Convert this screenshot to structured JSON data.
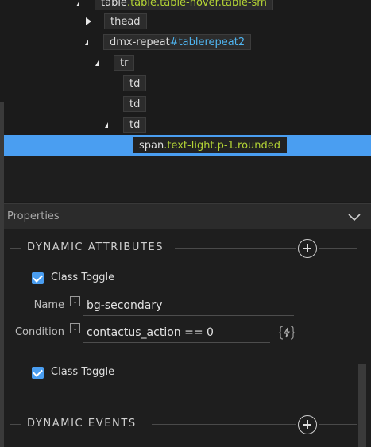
{
  "tree": {
    "nodes": [
      {
        "base": "table",
        "extra": ".table.table-hover.table-sm",
        "extra_color": "green"
      },
      {
        "base": "thead",
        "extra": ""
      },
      {
        "base": "dmx-repeat",
        "extra": "#tablerepeat2",
        "extra_color": "blue"
      },
      {
        "base": "tr",
        "extra": ""
      },
      {
        "base": "td",
        "extra": ""
      },
      {
        "base": "td",
        "extra": ""
      },
      {
        "base": "td",
        "extra": ""
      },
      {
        "base": "span",
        "extra": ".text-light.p-1.rounded",
        "extra_color": "green"
      }
    ]
  },
  "properties": {
    "title": "Properties",
    "dynamic_attributes": {
      "title": "DYNAMIC ATTRIBUTES",
      "items": [
        {
          "type_label": "Class Toggle",
          "checked": true,
          "name_label": "Name",
          "name_value": "bg-secondary",
          "condition_label": "Condition",
          "condition_value": "contactus_action == 0"
        },
        {
          "type_label": "Class Toggle",
          "checked": true
        }
      ]
    },
    "dynamic_events": {
      "title": "DYNAMIC EVENTS"
    }
  },
  "icons": {
    "collapse": "chevron-down-icon",
    "add": "plus-circle-icon",
    "info": "info-icon",
    "bolt": "lightning-bolt-icon",
    "expand": "triangle-right-icon",
    "collapse_node": "triangle-down-icon"
  },
  "colors": {
    "selection": "#4a9ef1",
    "class_highlight": "#b3d335",
    "id_highlight": "#4fb4ef",
    "panel_bg": "#1e1e1e"
  }
}
